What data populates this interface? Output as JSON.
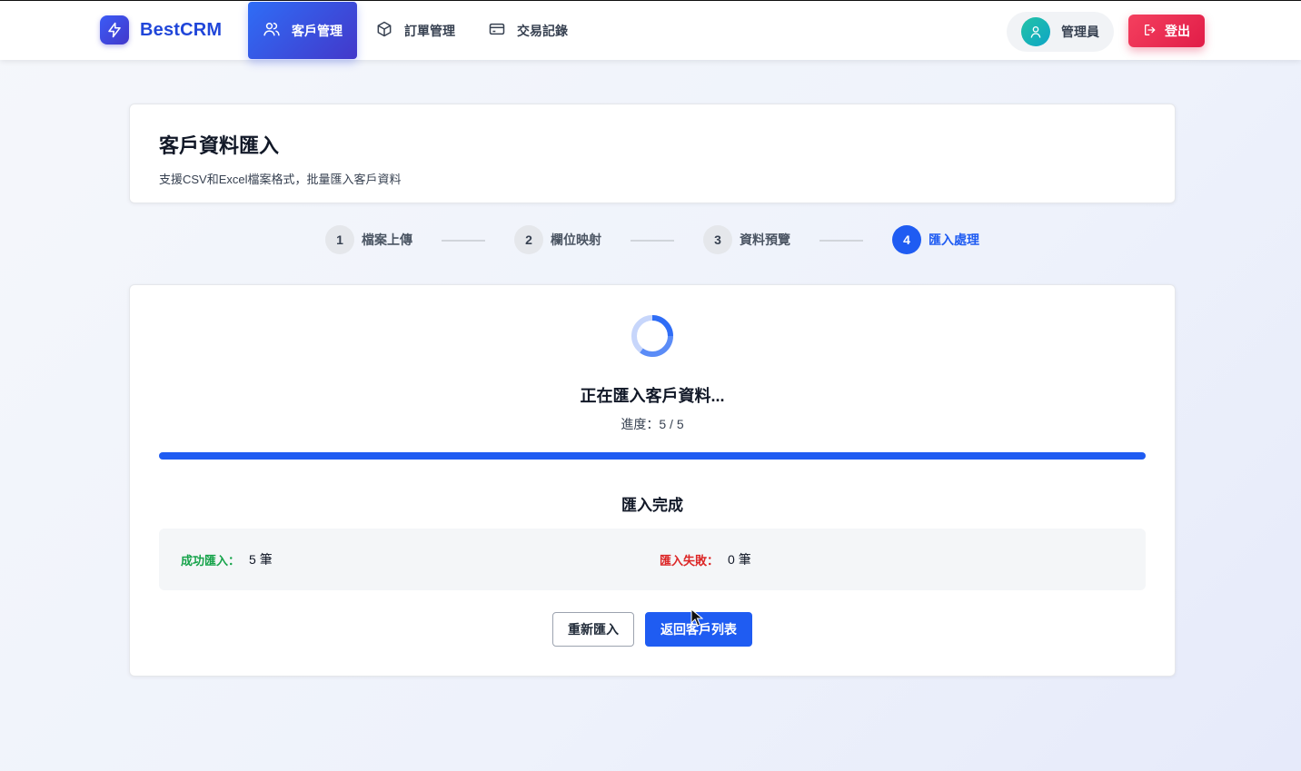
{
  "app": {
    "brand_name": "BestCRM"
  },
  "nav": {
    "items": [
      {
        "label": "客戶管理",
        "icon": "customers-icon",
        "active": true
      },
      {
        "label": "訂單管理",
        "icon": "box-icon",
        "active": false
      },
      {
        "label": "交易記錄",
        "icon": "credit-card-icon",
        "active": false
      }
    ]
  },
  "user": {
    "name": "管理員",
    "icon": "user-icon"
  },
  "logout": {
    "label": "登出",
    "icon": "logout-icon"
  },
  "page": {
    "title": "客戶資料匯入",
    "subtitle": "支援CSV和Excel檔案格式，批量匯入客戶資料"
  },
  "steps": [
    {
      "number": "1",
      "label": "檔案上傳",
      "active": false
    },
    {
      "number": "2",
      "label": "欄位映射",
      "active": false
    },
    {
      "number": "3",
      "label": "資料預覽",
      "active": false
    },
    {
      "number": "4",
      "label": "匯入處理",
      "active": true
    }
  ],
  "import": {
    "status_title": "正在匯入客戶資料...",
    "progress_text": "進度：5 / 5",
    "progress_fraction": 1.0,
    "done_title": "匯入完成",
    "success_label": "成功匯入：",
    "success_value": "5 筆",
    "fail_label": "匯入失敗：",
    "fail_value": "0 筆"
  },
  "buttons": {
    "reimport_label": "重新匯入",
    "back_label": "返回客戶列表"
  },
  "colors": {
    "primary": "#1f5cf2",
    "brand": "#2046d9",
    "danger": "#e11d48",
    "success": "#16a34a",
    "fail": "#dc2626"
  }
}
